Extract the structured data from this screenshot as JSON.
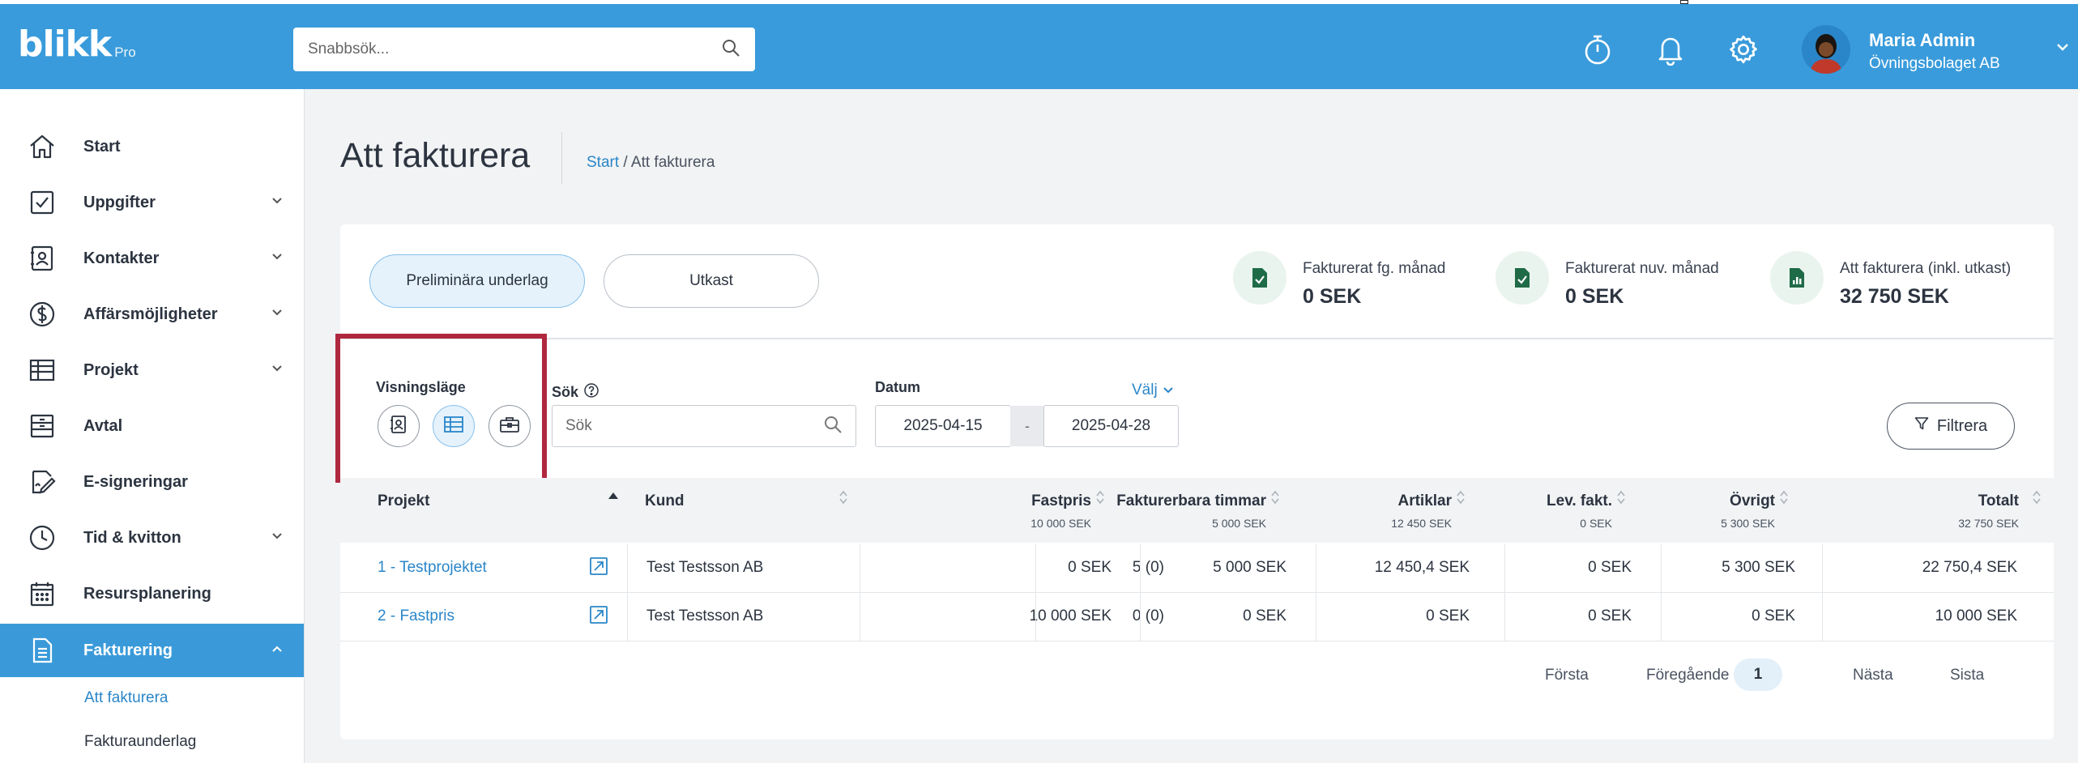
{
  "app": {
    "logo": "blikk",
    "logo_sub": "Pro"
  },
  "topbar": {
    "search_placeholder": "Snabbsök...",
    "icons": [
      "timer-icon",
      "bell-icon",
      "gear-icon"
    ],
    "user_name": "Maria Admin",
    "user_company": "Övningsbolaget AB"
  },
  "sidebar": {
    "items": [
      {
        "label": "Start",
        "icon": "home-icon",
        "expandable": false
      },
      {
        "label": "Uppgifter",
        "icon": "checkbox-icon",
        "expandable": true
      },
      {
        "label": "Kontakter",
        "icon": "contact-card-icon",
        "expandable": true
      },
      {
        "label": "Affärsmöjligheter",
        "icon": "dollar-circle-icon",
        "expandable": true
      },
      {
        "label": "Projekt",
        "icon": "table-icon",
        "expandable": true
      },
      {
        "label": "Avtal",
        "icon": "archive-icon",
        "expandable": false
      },
      {
        "label": "E-signeringar",
        "icon": "signature-icon",
        "expandable": false
      },
      {
        "label": "Tid & kvitton",
        "icon": "clock-icon",
        "expandable": true
      },
      {
        "label": "Resursplanering",
        "icon": "calendar-icon",
        "expandable": false
      },
      {
        "label": "Fakturering",
        "icon": "document-icon",
        "expandable": true,
        "active": true
      }
    ],
    "subitems": [
      {
        "label": "Att fakturera",
        "active": true
      },
      {
        "label": "Fakturaunderlag"
      }
    ]
  },
  "page": {
    "title": "Att fakturera",
    "breadcrumb_link": "Start",
    "breadcrumb_sep": " / ",
    "breadcrumb_current": "Att fakturera"
  },
  "tabs": {
    "active": "Preliminära underlag",
    "other": "Utkast"
  },
  "stats": [
    {
      "label": "Fakturerat fg. månad",
      "value": "0 SEK",
      "icon": "doc-check-icon"
    },
    {
      "label": "Fakturerat nuv. månad",
      "value": "0 SEK",
      "icon": "doc-check-icon"
    },
    {
      "label": "Att fakturera (inkl. utkast)",
      "value": "32 750 SEK",
      "icon": "doc-chart-icon"
    }
  ],
  "filters": {
    "view_label": "Visningsläge",
    "view_modes": [
      "contact-view-icon",
      "table-view-icon",
      "briefcase-view-icon"
    ],
    "active_view": 1,
    "search_label": "Sök",
    "search_placeholder": "Sök",
    "date_label": "Datum",
    "date_pick": "Välj",
    "date_from": "2025-04-15",
    "date_sep": "-",
    "date_to": "2025-04-28",
    "filter_button": "Filtrera"
  },
  "table": {
    "columns": [
      {
        "label": "Projekt",
        "sub": ""
      },
      {
        "label": "Kund",
        "sub": ""
      },
      {
        "label": "Fastpris",
        "sub": "10 000 SEK"
      },
      {
        "label": "Fakturerbara timmar",
        "sub": "5 000 SEK"
      },
      {
        "label": "Artiklar",
        "sub": "12 450 SEK"
      },
      {
        "label": "Lev. fakt.",
        "sub": "0 SEK"
      },
      {
        "label": "Övrigt",
        "sub": "5 300 SEK"
      },
      {
        "label": "Totalt",
        "sub": "32 750 SEK"
      }
    ],
    "rows": [
      {
        "project": "1 - Testprojektet",
        "customer": "Test Testsson AB",
        "fixed": "0 SEK",
        "hours": "5 (0)",
        "hours_amount": "5 000 SEK",
        "articles": "12 450,4 SEK",
        "delivery": "0 SEK",
        "other": "5 300 SEK",
        "total": "22 750,4 SEK"
      },
      {
        "project": "2 - Fastpris",
        "customer": "Test Testsson AB",
        "fixed": "10 000 SEK",
        "hours": "0 (0)",
        "hours_amount": "0 SEK",
        "articles": "0 SEK",
        "delivery": "0 SEK",
        "other": "0 SEK",
        "total": "10 000 SEK"
      }
    ]
  },
  "pagination": {
    "first": "Första",
    "prev": "Föregående",
    "current": "1",
    "next": "Nästa",
    "last": "Sista"
  },
  "colors": {
    "primary": "#399bdb",
    "accent_link": "#2a86c8",
    "highlight": "#b0283f",
    "stat_icon": "#1f6b47"
  }
}
